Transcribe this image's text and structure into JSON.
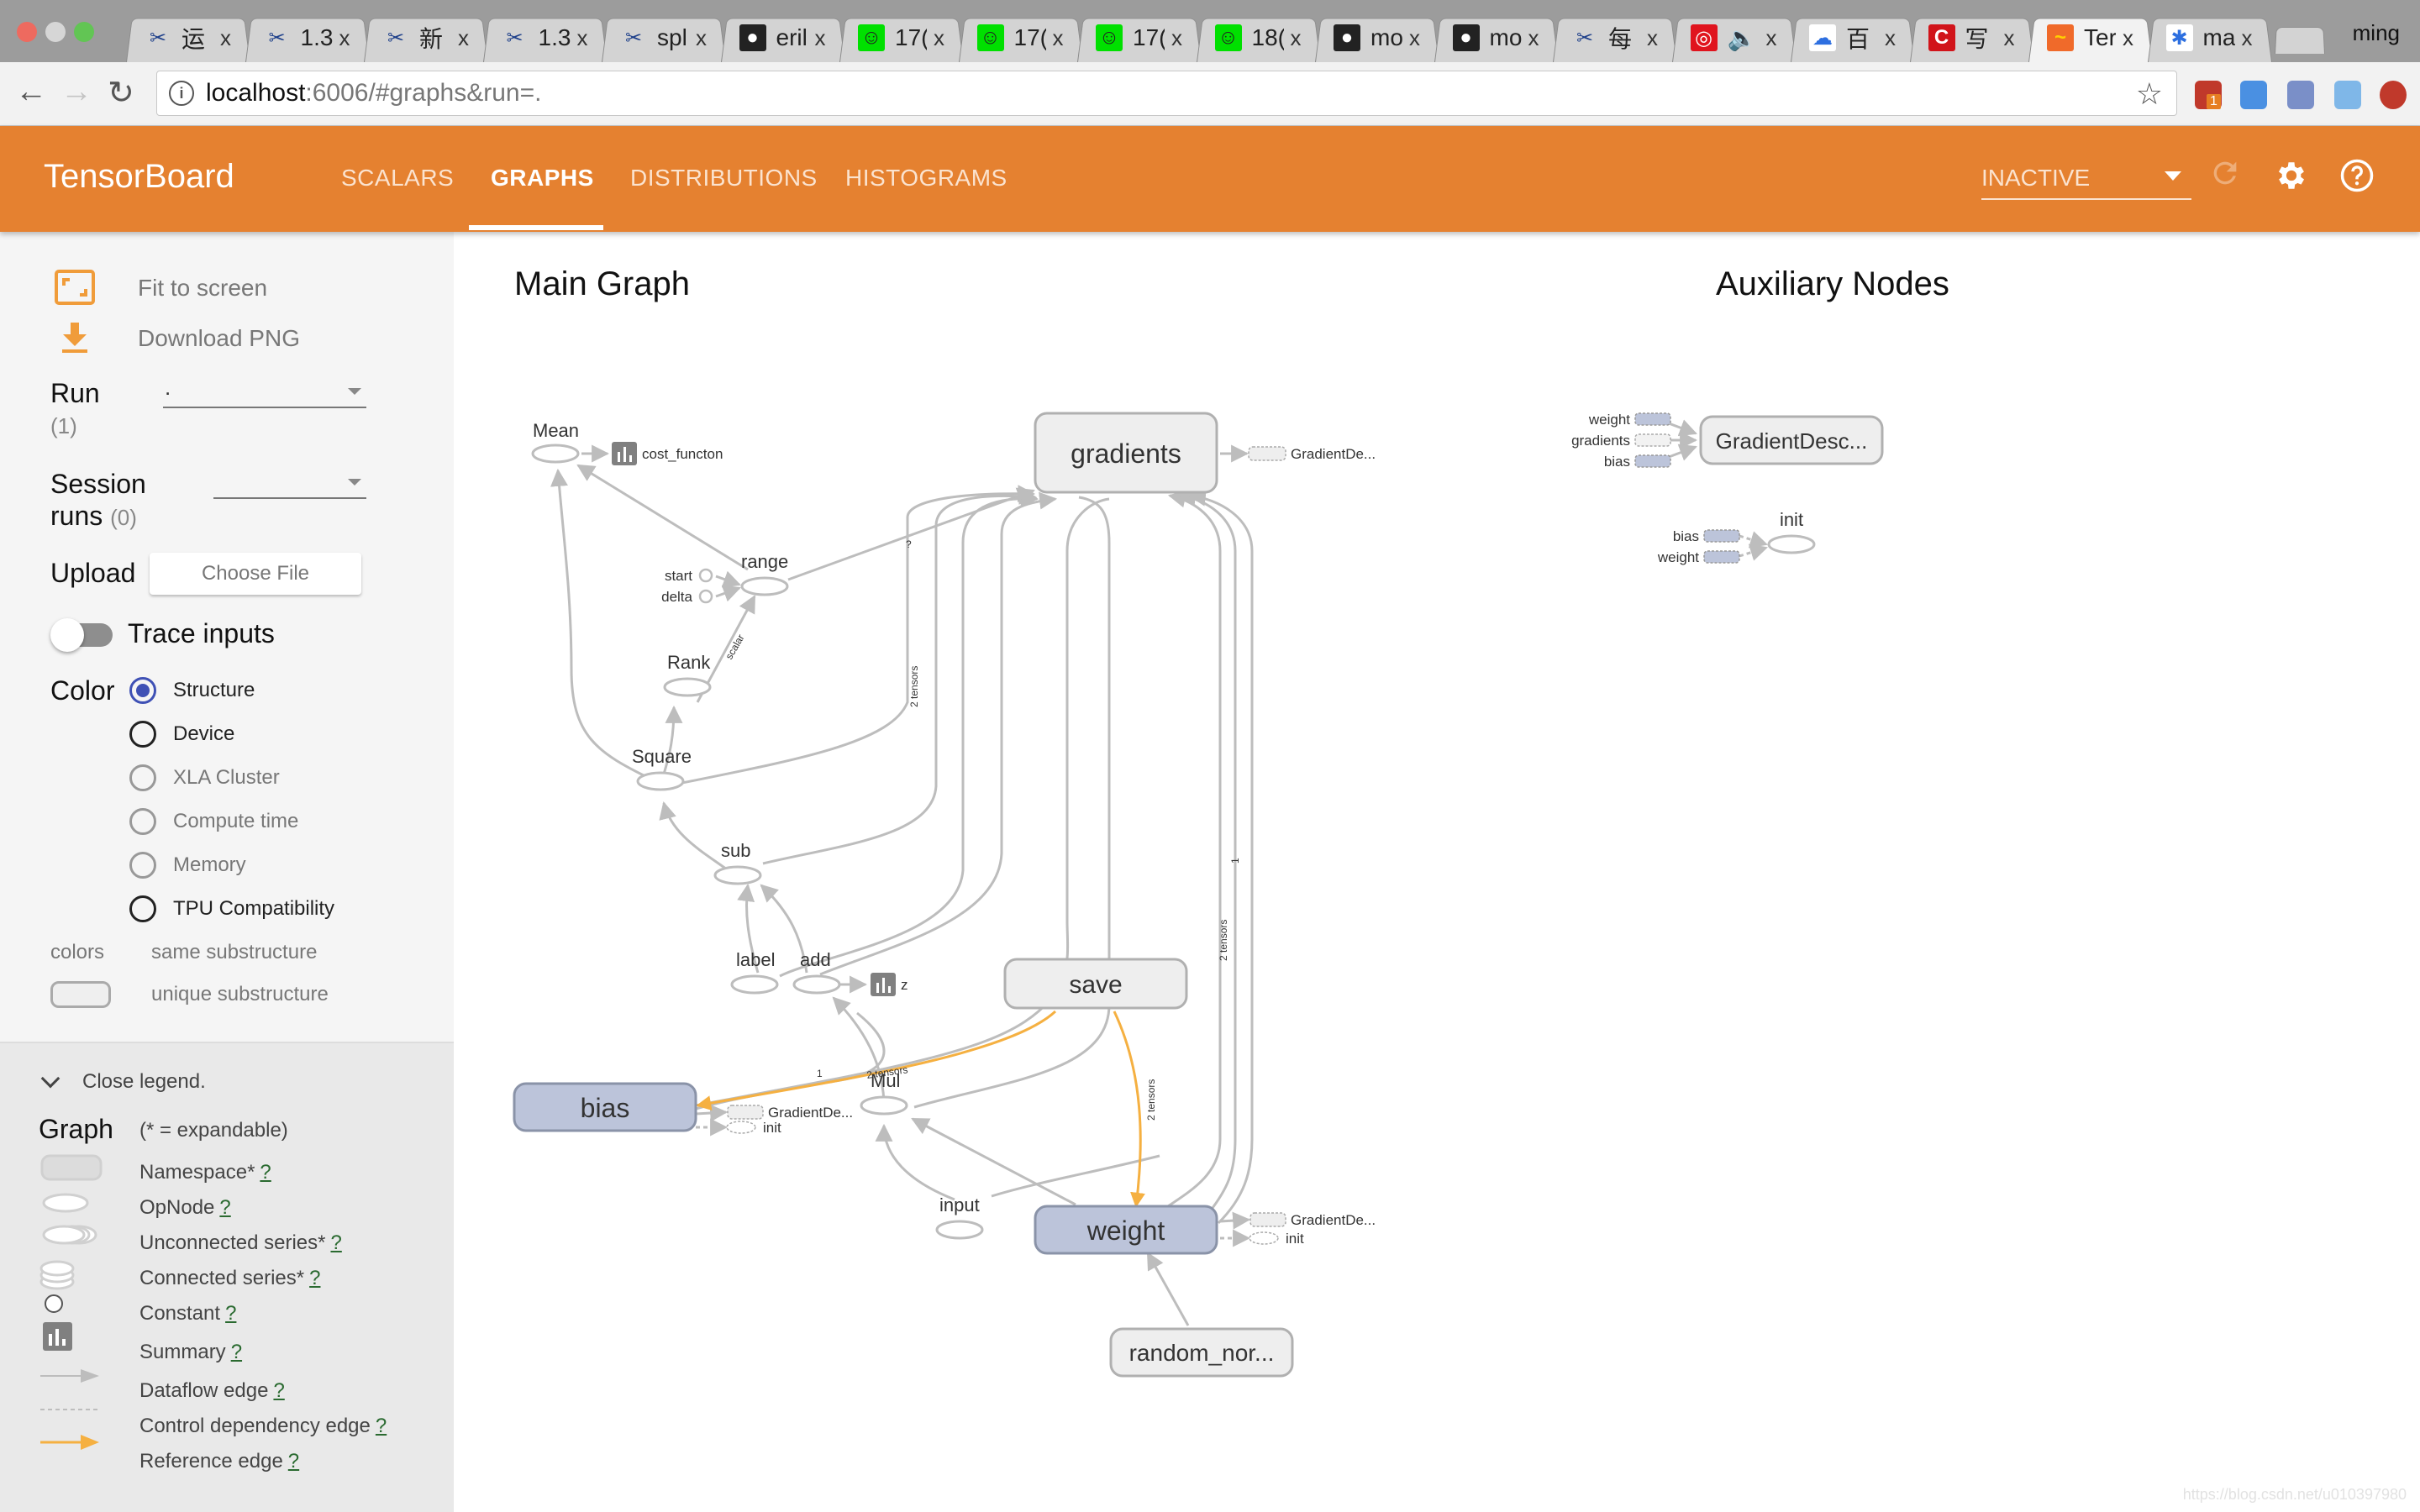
{
  "browser": {
    "tabs": [
      {
        "title": "运",
        "favicon": "scissors-icon"
      },
      {
        "title": "1.3",
        "favicon": "scissors-icon"
      },
      {
        "title": "新",
        "favicon": "scissors-icon"
      },
      {
        "title": "1.3",
        "favicon": "scissors-icon"
      },
      {
        "title": "spl",
        "favicon": "scissors-icon"
      },
      {
        "title": "eril",
        "favicon": "github-icon"
      },
      {
        "title": "17(",
        "favicon": "smiley-icon"
      },
      {
        "title": "17(",
        "favicon": "smiley-icon"
      },
      {
        "title": "17(",
        "favicon": "smiley-icon"
      },
      {
        "title": "18(",
        "favicon": "smiley-icon"
      },
      {
        "title": "mo",
        "favicon": "github-icon"
      },
      {
        "title": "mo",
        "favicon": "github-icon"
      },
      {
        "title": "每",
        "favicon": "scissors-icon"
      },
      {
        "title": "",
        "favicon": "netease-music-icon",
        "audio": true
      },
      {
        "title": "百",
        "favicon": "baidu-cloud-icon"
      },
      {
        "title": "写",
        "favicon": "csdn-icon"
      },
      {
        "title": "Ter",
        "favicon": "tensorboard-icon",
        "active": true
      },
      {
        "title": "ma",
        "favicon": "baidu-paw-icon"
      }
    ],
    "tab_close": "x",
    "profile_name": "ming",
    "url_host": "localhost",
    "url_rest": ":6006/#graphs&run=.",
    "extension_badge": "1"
  },
  "header": {
    "title": "TensorBoard",
    "tabs": [
      {
        "label": "SCALARS",
        "active": false
      },
      {
        "label": "GRAPHS",
        "active": true
      },
      {
        "label": "DISTRIBUTIONS",
        "active": false
      },
      {
        "label": "HISTOGRAMS",
        "active": false
      }
    ],
    "status_select": "INACTIVE"
  },
  "sidebar": {
    "fit_to_screen": "Fit to screen",
    "download_png": "Download PNG",
    "run_label": "Run",
    "run_count": "(1)",
    "run_value": ".",
    "session_label_1": "Session",
    "session_label_2": "runs",
    "session_count": "(0)",
    "session_value": "",
    "upload_label": "Upload",
    "choose_file": "Choose File",
    "trace_inputs": "Trace inputs",
    "trace_inputs_on": false,
    "color_label": "Color",
    "color_options": [
      {
        "label": "Structure",
        "checked": true,
        "disabled": false
      },
      {
        "label": "Device",
        "checked": false,
        "disabled": false
      },
      {
        "label": "XLA Cluster",
        "checked": false,
        "disabled": true
      },
      {
        "label": "Compute time",
        "checked": false,
        "disabled": true
      },
      {
        "label": "Memory",
        "checked": false,
        "disabled": true
      },
      {
        "label": "TPU Compatibility",
        "checked": false,
        "disabled": false
      }
    ],
    "colors_label": "colors",
    "same_substructure": "same substructure",
    "unique_substructure": "unique substructure"
  },
  "legend": {
    "toggle": "Close legend.",
    "graph_label": "Graph",
    "expandable_note": "(* = expandable)",
    "help_mark": "?",
    "items": [
      {
        "label": "Namespace*",
        "symbol": "namespace"
      },
      {
        "label": "OpNode",
        "symbol": "opnode"
      },
      {
        "label": "Unconnected series*",
        "symbol": "unconnected-series"
      },
      {
        "label": "Connected series*",
        "symbol": "connected-series"
      },
      {
        "label": "Constant",
        "symbol": "constant"
      },
      {
        "label": "Summary",
        "symbol": "summary"
      },
      {
        "label": "Dataflow edge",
        "symbol": "dataflow-edge"
      },
      {
        "label": "Control dependency edge",
        "symbol": "control-edge"
      },
      {
        "label": "Reference edge",
        "symbol": "reference-edge"
      }
    ]
  },
  "graph": {
    "main_title": "Main Graph",
    "aux_title": "Auxiliary Nodes",
    "nodes": {
      "mean": "Mean",
      "cost_function": "cost_functon",
      "range": "range",
      "start": "start",
      "delta": "delta",
      "rank": "Rank",
      "square": "Square",
      "sub": "sub",
      "label": "label",
      "add": "add",
      "z": "z",
      "gradients": "gradients",
      "save": "save",
      "bias": "bias",
      "mul": "Mul",
      "input": "input",
      "weight": "weight",
      "random_normal": "random_nor...",
      "gradient_de": "GradientDe...",
      "init": "init"
    },
    "edge_labels": {
      "scalar": "scalar",
      "two_tensors": "2 tensors",
      "one": "1",
      "question": "?"
    },
    "aux": {
      "gradient_desc": "GradientDesc...",
      "gd_inputs": [
        "weight",
        "gradients",
        "bias"
      ],
      "init": "init",
      "init_inputs": [
        "bias",
        "weight"
      ]
    },
    "colors": {
      "edge": "#bdbdbd",
      "reference_edge": "#f5b041",
      "namespace_fill": "#eeeeee",
      "variable_fill": "#bcc4da"
    }
  },
  "watermark": "https://blog.csdn.net/u010397980"
}
